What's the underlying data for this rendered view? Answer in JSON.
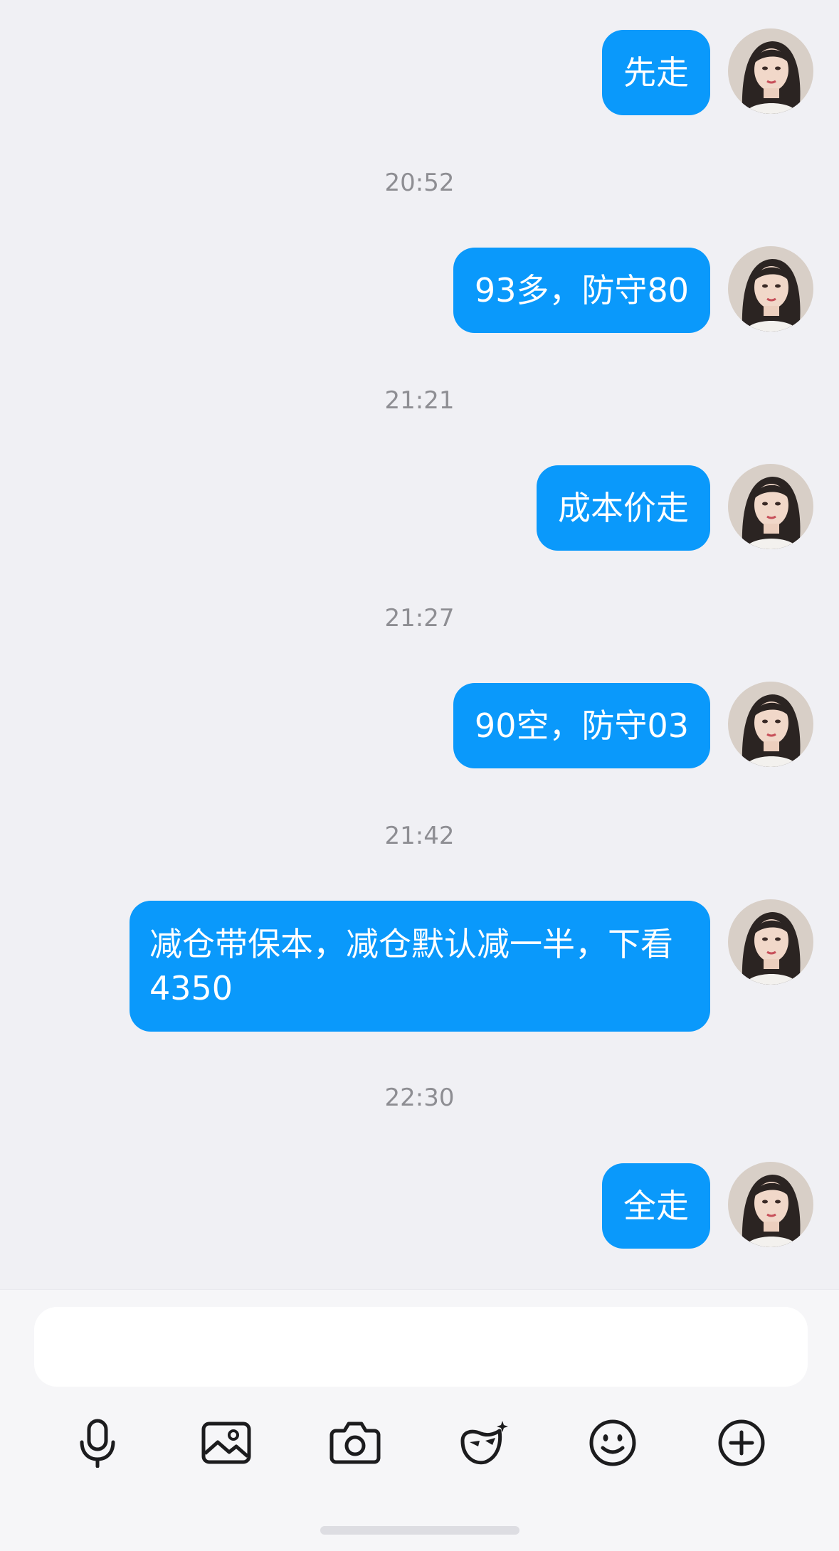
{
  "messages": [
    {
      "time": "",
      "text": "先走"
    },
    {
      "time": "20:52",
      "text": "93多，防守80"
    },
    {
      "time": "21:21",
      "text": "成本价走"
    },
    {
      "time": "21:27",
      "text": "90空，防守03"
    },
    {
      "time": "21:42",
      "text": "减仓带保本，减仓默认减一半，下看4350"
    },
    {
      "time": "22:30",
      "text": "全走"
    }
  ],
  "composer": {
    "input_placeholder": "",
    "tools": [
      "microphone-icon",
      "image-icon",
      "camera-icon",
      "mask-sparkle-icon",
      "smiley-icon",
      "plus-circle-icon"
    ]
  },
  "colors": {
    "bubble": "#0a99fb",
    "background": "#f0f0f4",
    "timestamp": "#8e8e93"
  }
}
